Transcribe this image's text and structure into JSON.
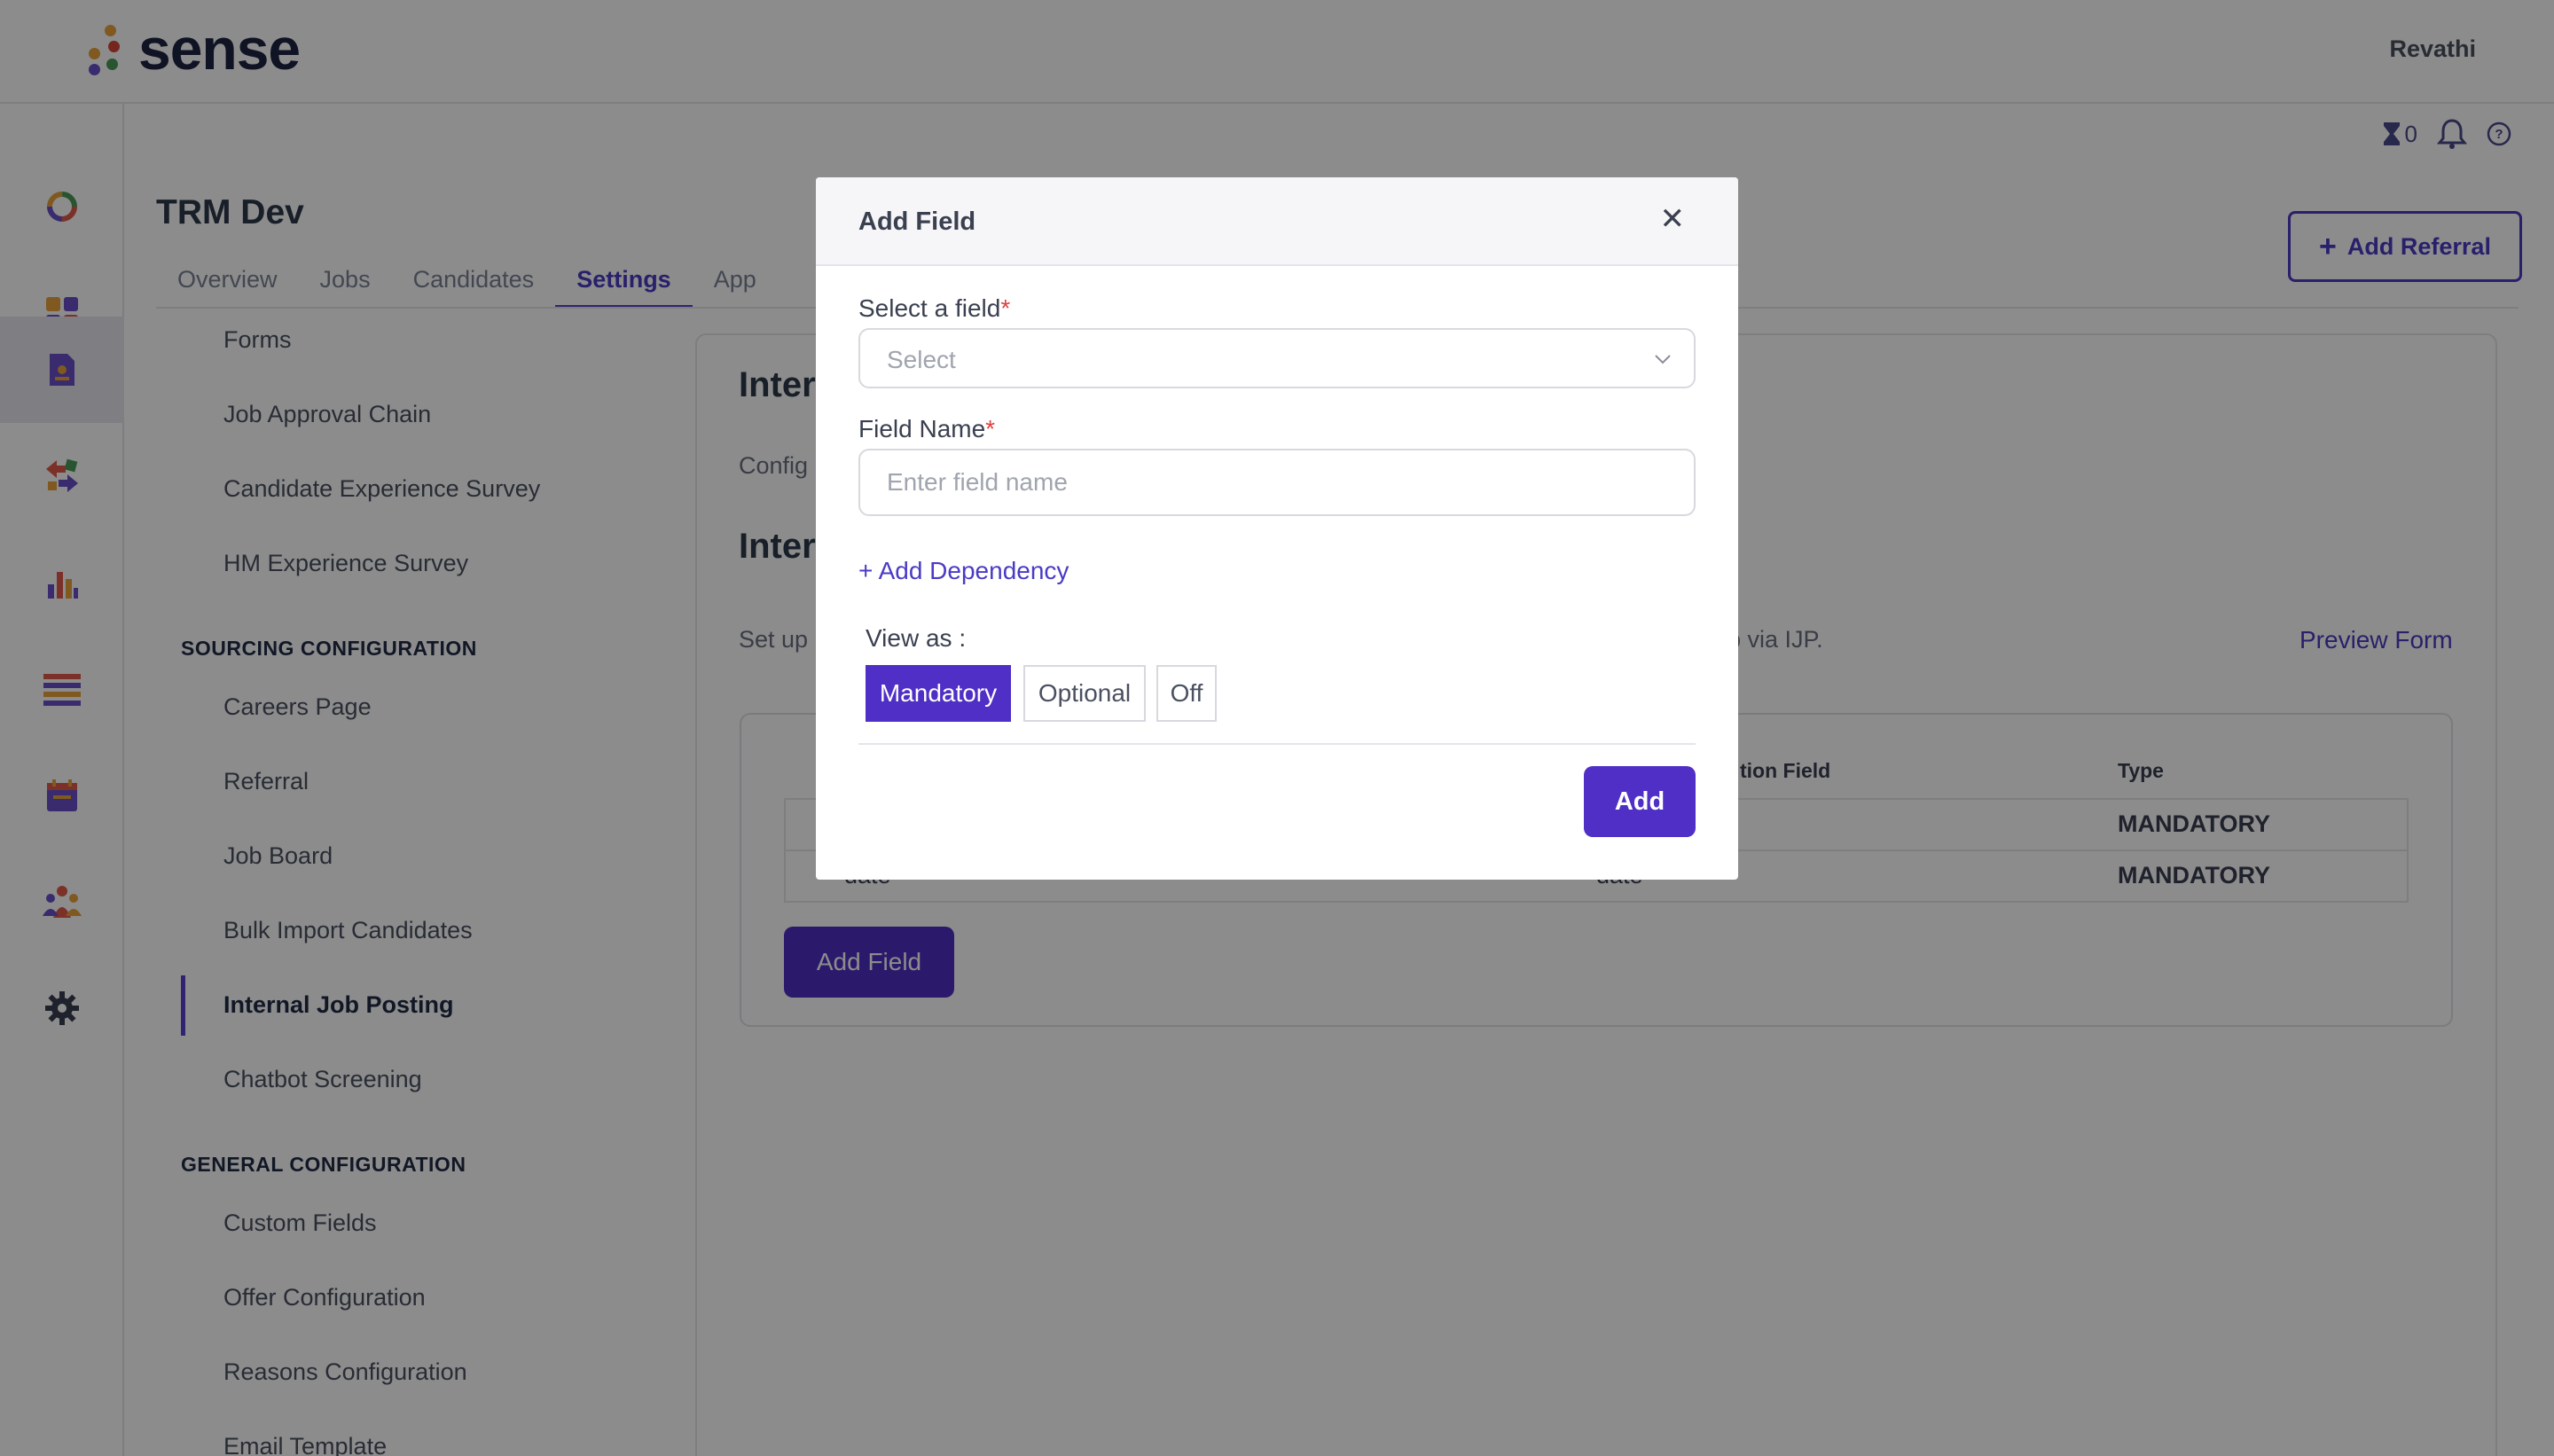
{
  "app": {
    "logo_text": "sense",
    "user_name": "Revathi"
  },
  "header_icons": {
    "hourglass_count": "0"
  },
  "page": {
    "title": "TRM Dev",
    "tabs": [
      "Overview",
      "Jobs",
      "Candidates",
      "Settings",
      "App"
    ],
    "active_tab": "Settings",
    "add_referral_label": "Add Referral"
  },
  "settings_menu": {
    "items_top": [
      "Forms",
      "Job Approval Chain",
      "Candidate Experience Survey",
      "HM Experience Survey"
    ],
    "sourcing_section": "SOURCING CONFIGURATION",
    "sourcing_items": [
      "Careers Page",
      "Referral",
      "Job Board",
      "Bulk Import Candidates",
      "Internal Job Posting",
      "Chatbot Screening"
    ],
    "general_section": "GENERAL CONFIGURATION",
    "general_items": [
      "Custom Fields",
      "Offer Configuration",
      "Reasons Configuration",
      "Email Template"
    ],
    "active_item": "Internal Job Posting"
  },
  "main": {
    "heading1": "Inter",
    "config_text": "Config",
    "heading2": "Inter",
    "desc_start": "Set up",
    "desc_end": "b via IJP.",
    "preview_form": "Preview Form",
    "table": {
      "col_mid": "tion Field",
      "col_type": "Type",
      "rows": [
        {
          "name": "",
          "field": "",
          "type": "MANDATORY"
        },
        {
          "name": "date",
          "field": "date",
          "type": "MANDATORY"
        }
      ]
    },
    "add_field_button": "Add Field"
  },
  "modal": {
    "title": "Add Field",
    "select_label": "Select a field",
    "select_placeholder": "Select",
    "name_label": "Field Name",
    "name_placeholder": "Enter field name",
    "required_mark": "*",
    "add_dependency": "+ Add Dependency",
    "view_as_label": "View as :",
    "view_options": [
      "Mandatory",
      "Optional",
      "Off"
    ],
    "selected_view": "Mandatory",
    "add_button": "Add"
  },
  "colors": {
    "accent": "#4f2fc5",
    "overlay": "rgba(0,0,0,0.45)"
  }
}
